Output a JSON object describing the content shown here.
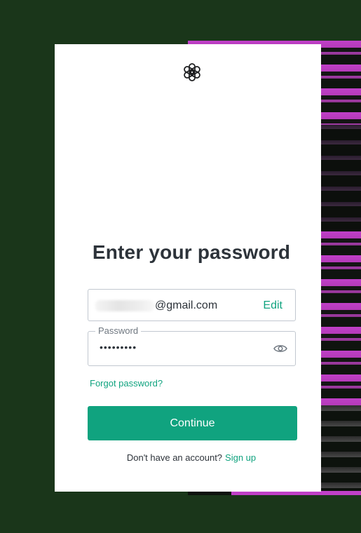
{
  "logo": {
    "icon": "openai-logo-icon"
  },
  "heading": "Enter your password",
  "email": {
    "redacted_prefix": "",
    "domain_text": "@gmail.com",
    "edit_label": "Edit"
  },
  "password": {
    "label": "Password",
    "masked_value": "•••••••••",
    "toggle_icon": "eye-icon"
  },
  "forgot_label": "Forgot password?",
  "continue_label": "Continue",
  "signup": {
    "prompt": "Don't have an account?",
    "link_label": "Sign up"
  },
  "colors": {
    "accent": "#10a37f",
    "text": "#2d333a",
    "border": "#c2c8d0",
    "page_bg": "#1a361a"
  }
}
